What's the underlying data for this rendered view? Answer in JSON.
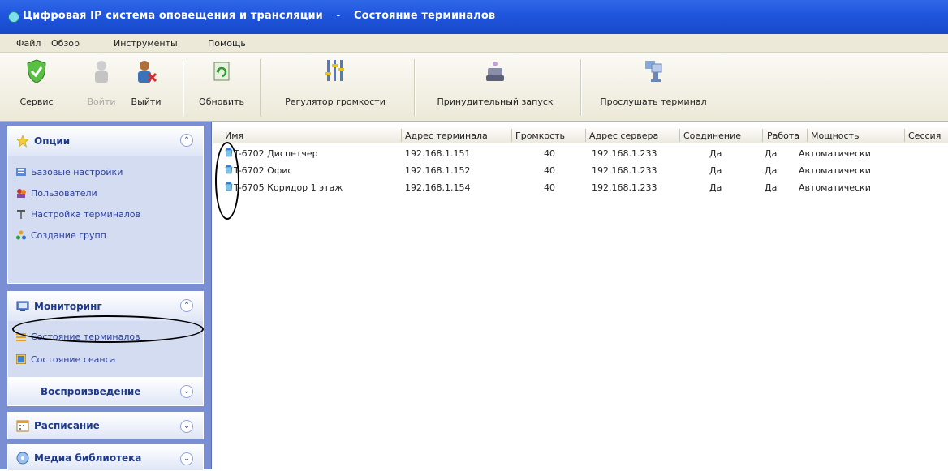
{
  "window": {
    "app_title": "Цифровая IP система оповещения и трансляции",
    "separator": "-",
    "view_title": "Состояние терминалов"
  },
  "menu": [
    "Файл",
    "Обзор",
    "Инструменты",
    "Помощь"
  ],
  "toolbar": [
    {
      "label": "Сервис",
      "icon": "shield-check-icon",
      "enabled": true
    },
    {
      "label": "Войти",
      "icon": "user-login-icon",
      "enabled": false
    },
    {
      "label": "Выйти",
      "icon": "user-logout-icon",
      "enabled": true
    },
    {
      "label": "Обновить",
      "icon": "refresh-icon",
      "enabled": true
    },
    {
      "label": "Регулятор громкости",
      "icon": "volume-slider-icon",
      "enabled": true
    },
    {
      "label": "Принудительный запуск",
      "icon": "force-start-icon",
      "enabled": true
    },
    {
      "label": "Прослушать терминал",
      "icon": "listen-terminal-icon",
      "enabled": true
    }
  ],
  "sidebar": {
    "options": {
      "title": "Опции",
      "items": [
        "Базовые настройки",
        "Пользователи",
        "Настройка терминалов",
        "Создание групп"
      ]
    },
    "monitoring": {
      "title": "Мониторинг",
      "items": [
        "Состояние терминалов",
        "Состояние сеанса"
      ]
    },
    "playback": {
      "title": "Воспроизведение"
    },
    "schedule": {
      "title": "Расписание"
    },
    "media": {
      "title": "Медиа библиотека"
    }
  },
  "table": {
    "columns": [
      "Имя",
      "Адрес терминала",
      "Громкость",
      "Адрес сервера",
      "Соединение",
      "Работа",
      "Мощность",
      "Сессия"
    ],
    "rows": [
      [
        "T-6702 Диспетчер",
        "192.168.1.151",
        "40",
        "192.168.1.233",
        "Да",
        "Да",
        "Автоматически"
      ],
      [
        "T-6702 Офис",
        "192.168.1.152",
        "40",
        "192.168.1.233",
        "Да",
        "Да",
        "Автоматически"
      ],
      [
        "T-6705 Коридор 1 этаж",
        "192.168.1.154",
        "40",
        "192.168.1.233",
        "Да",
        "Да",
        "Автоматически"
      ]
    ]
  },
  "colors": {
    "titlebar": "#1f55dd",
    "sidebar_bg": "#7a8fd3",
    "panel_bg": "#d4dcf2",
    "link": "#2b3f9d"
  }
}
